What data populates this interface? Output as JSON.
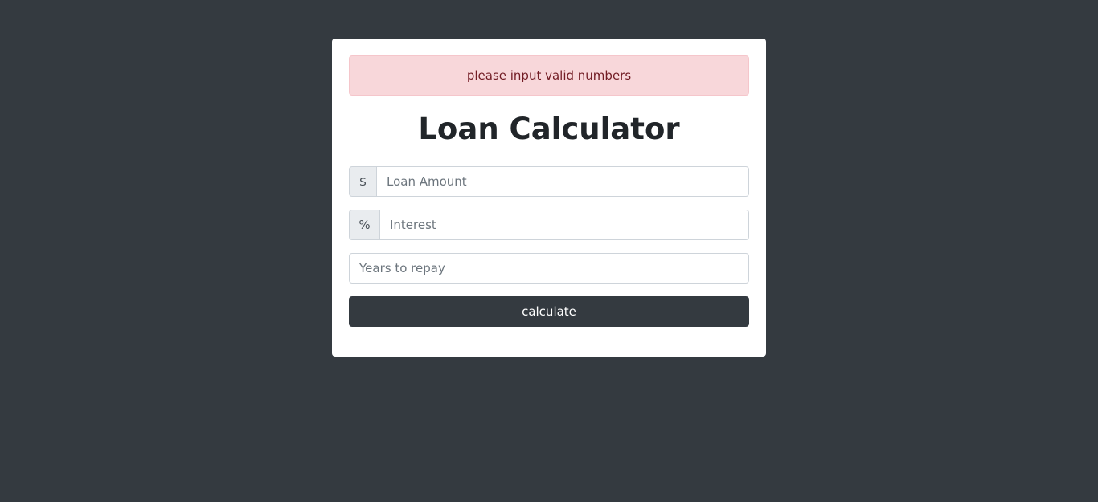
{
  "alert": {
    "message": "please input valid numbers"
  },
  "title": "Loan Calculator",
  "form": {
    "amount": {
      "prefix": "$",
      "placeholder": "Loan Amount",
      "value": ""
    },
    "interest": {
      "prefix": "%",
      "placeholder": "Interest",
      "value": ""
    },
    "years": {
      "placeholder": "Years to repay",
      "value": ""
    },
    "submit_label": "calculate"
  },
  "colors": {
    "page_background": "#343a40",
    "card_background": "#ffffff",
    "alert_background": "#f8d7da",
    "alert_text": "#721c24",
    "button_background": "#343a40",
    "button_text": "#ffffff"
  }
}
